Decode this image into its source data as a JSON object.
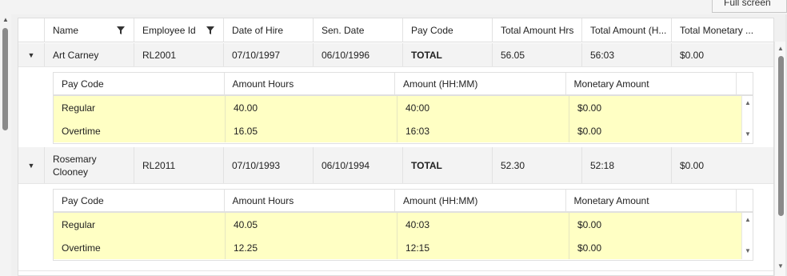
{
  "toolbar": {
    "fullscreen_label": "Full screen"
  },
  "grid": {
    "columns": [
      "Name",
      "Employee Id",
      "Date of Hire",
      "Sen. Date",
      "Pay Code",
      "Total Amount Hrs",
      "Total Amount (H...",
      "Total Monetary ..."
    ],
    "rows": [
      {
        "expander": "▼",
        "name": "Art Carney",
        "employee_id": "RL2001",
        "date_of_hire": "07/10/1997",
        "sen_date": "06/10/1996",
        "pay_code": "TOTAL",
        "total_amount_hrs": "56.05",
        "total_amount_hhmm": "56:03",
        "total_monetary": "$0.00",
        "detail": {
          "columns": [
            "Pay Code",
            "Amount Hours",
            "Amount (HH:MM)",
            "Monetary Amount"
          ],
          "rows": [
            {
              "pay_code": "Regular",
              "amount_hours": "40.00",
              "amount_hhmm": "40:00",
              "monetary": "$0.00"
            },
            {
              "pay_code": "Overtime",
              "amount_hours": "16.05",
              "amount_hhmm": "16:03",
              "monetary": "$0.00"
            }
          ]
        }
      },
      {
        "expander": "▼",
        "name": "Rosemary Clooney",
        "employee_id": "RL2011",
        "date_of_hire": "07/10/1993",
        "sen_date": "06/10/1994",
        "pay_code": "TOTAL",
        "total_amount_hrs": "52.30",
        "total_amount_hhmm": "52:18",
        "total_monetary": "$0.00",
        "detail": {
          "columns": [
            "Pay Code",
            "Amount Hours",
            "Amount (HH:MM)",
            "Monetary Amount"
          ],
          "rows": [
            {
              "pay_code": "Regular",
              "amount_hours": "40.05",
              "amount_hhmm": "40:03",
              "monetary": "$0.00"
            },
            {
              "pay_code": "Overtime",
              "amount_hours": "12.25",
              "amount_hhmm": "12:15",
              "monetary": "$0.00"
            }
          ]
        }
      }
    ]
  },
  "scroll": {
    "up_glyph": "▲",
    "down_glyph": "▼"
  }
}
